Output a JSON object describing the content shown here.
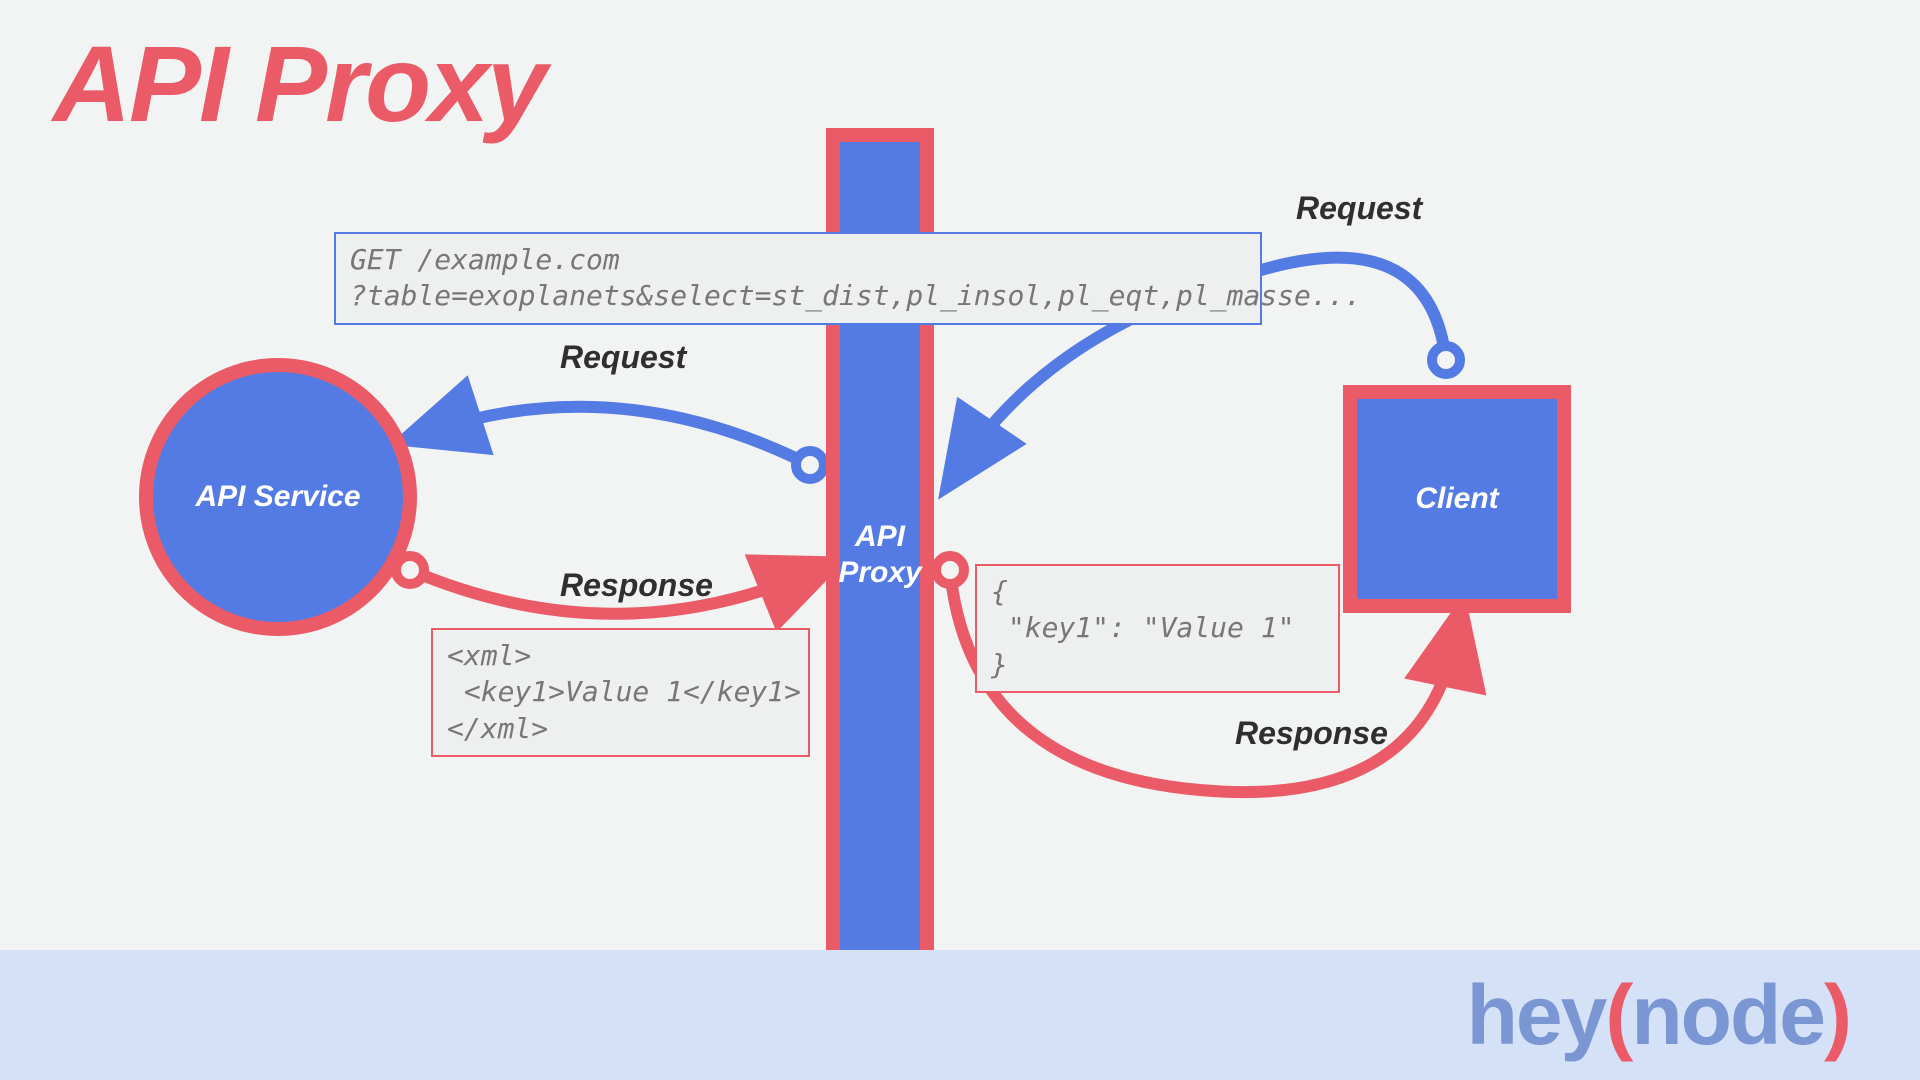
{
  "title": "API Proxy",
  "nodes": {
    "api_service": "API Service",
    "api_proxy": "API\nProxy",
    "client": "Client"
  },
  "flows": {
    "request_left": "Request",
    "response_left": "Response",
    "request_right": "Request",
    "response_right": "Response"
  },
  "code": {
    "get": "GET /example.com\n?table=exoplanets&select=st_dist,pl_insol,pl_eqt,pl_masse...",
    "xml": "<xml>\n <key1>Value 1</key1>\n</xml>",
    "json": "{\n \"key1\": \"Value 1\"\n}"
  },
  "brand": {
    "hey": "hey",
    "lp": "(",
    "node": "node",
    "rp": ")"
  },
  "colors": {
    "blue": "#547be3",
    "red": "#ea5b67",
    "bg": "#f2f3f3",
    "footer": "#d5e1f6"
  }
}
